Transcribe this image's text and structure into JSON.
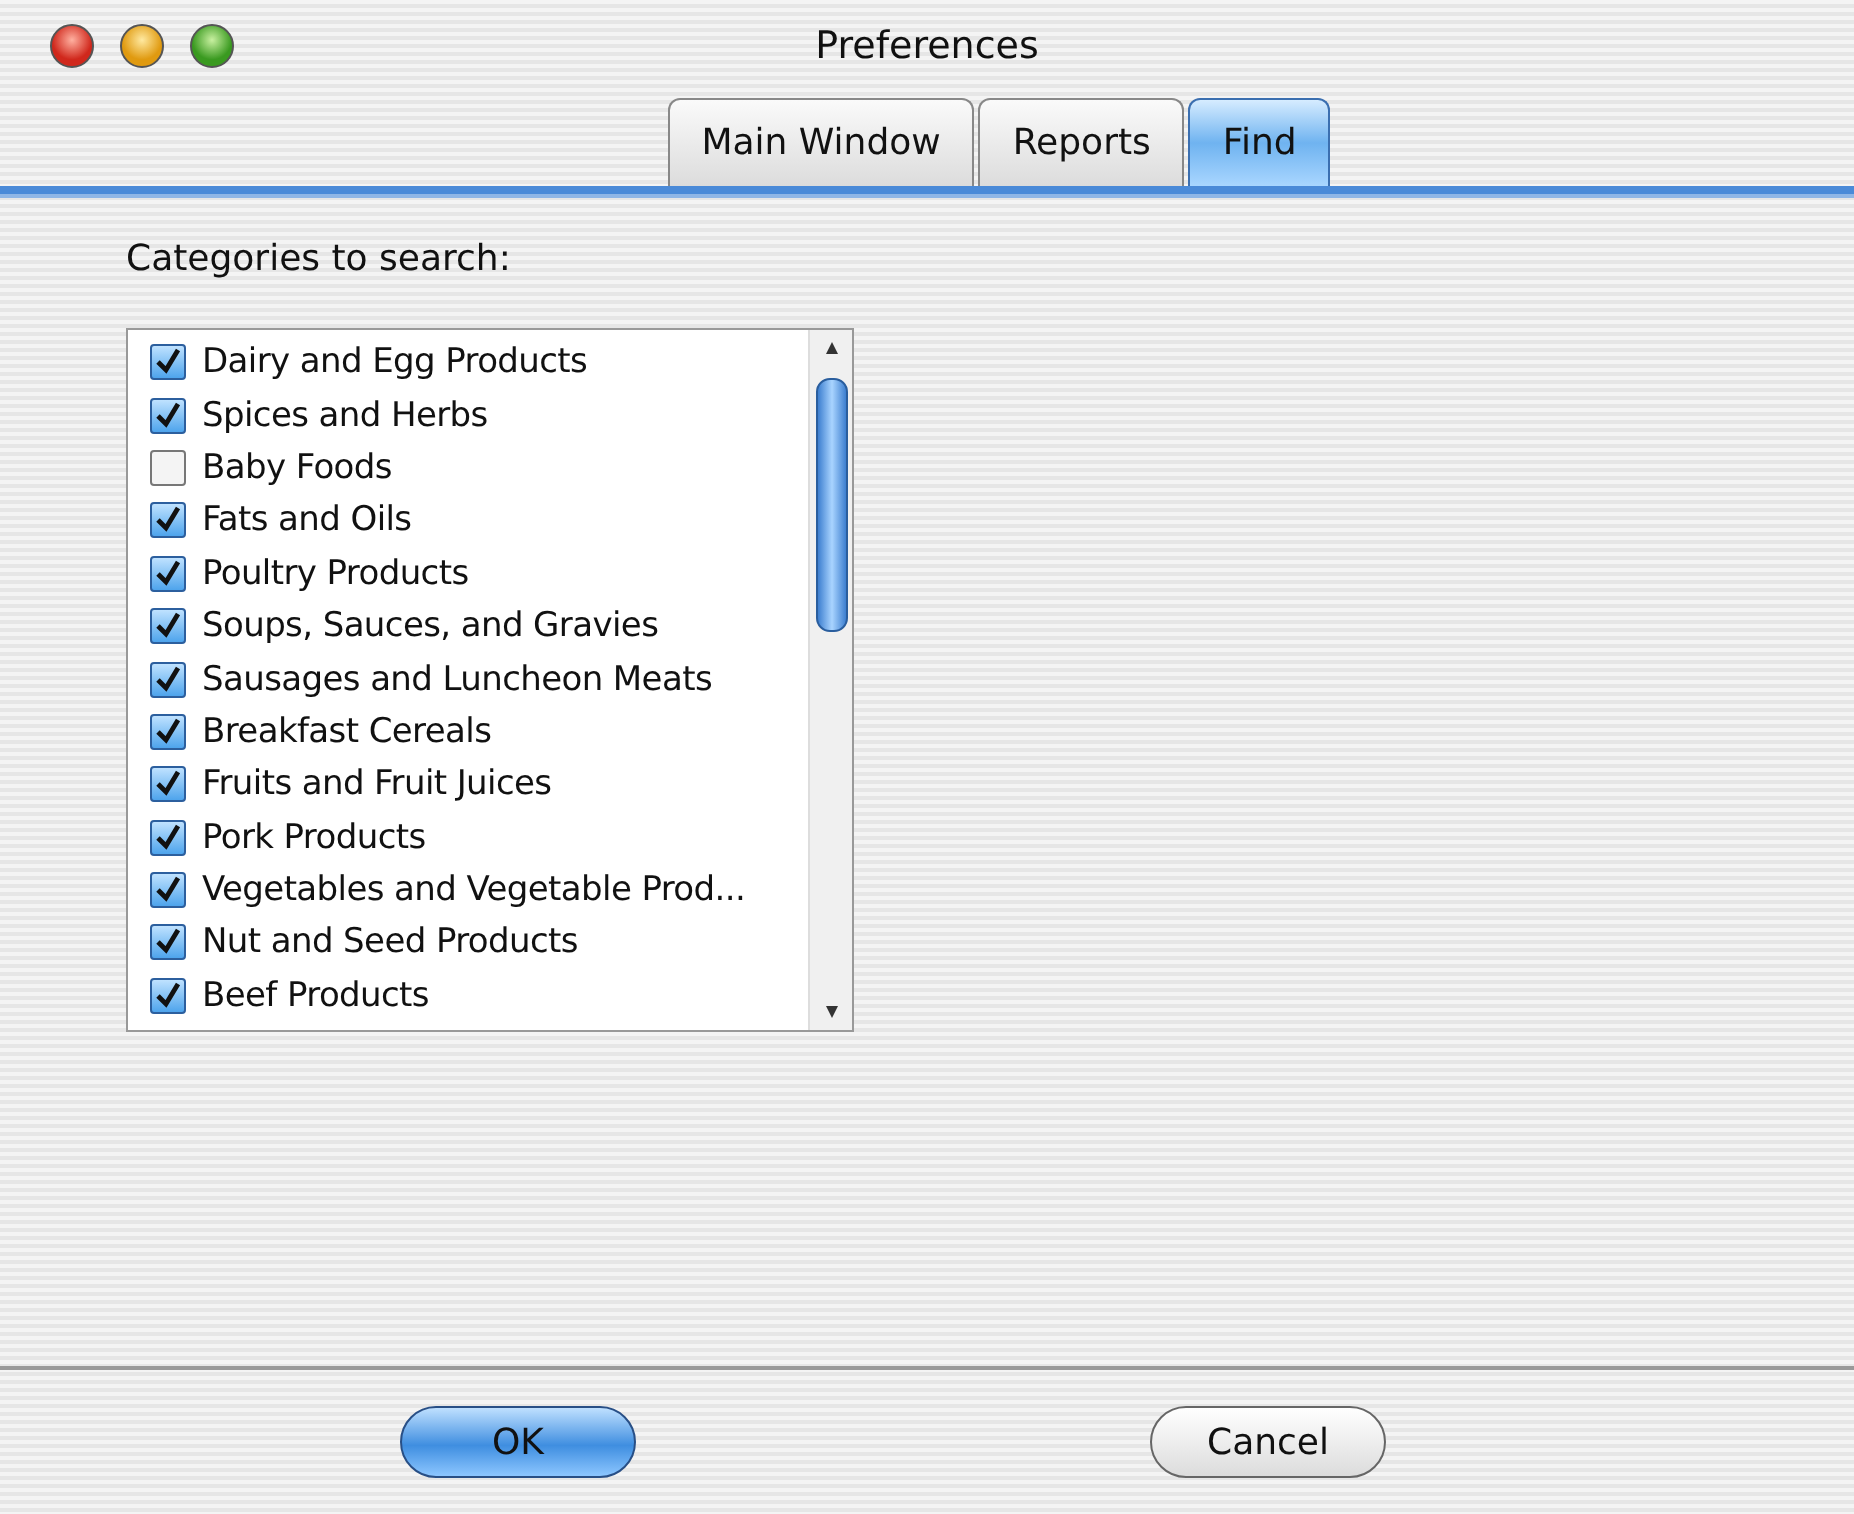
{
  "window": {
    "title": "Preferences"
  },
  "tabs": [
    {
      "label": "Main Window",
      "selected": false
    },
    {
      "label": "Reports",
      "selected": false
    },
    {
      "label": "Find",
      "selected": true
    }
  ],
  "categories_label": "Categories to search:",
  "categories": [
    {
      "label": "Dairy and Egg Products",
      "checked": true
    },
    {
      "label": "Spices and Herbs",
      "checked": true
    },
    {
      "label": "Baby Foods",
      "checked": false
    },
    {
      "label": "Fats and Oils",
      "checked": true
    },
    {
      "label": "Poultry Products",
      "checked": true
    },
    {
      "label": "Soups, Sauces, and Gravies",
      "checked": true
    },
    {
      "label": "Sausages and Luncheon Meats",
      "checked": true
    },
    {
      "label": "Breakfast Cereals",
      "checked": true
    },
    {
      "label": "Fruits and Fruit Juices",
      "checked": true
    },
    {
      "label": "Pork Products",
      "checked": true
    },
    {
      "label": "Vegetables and Vegetable Prod...",
      "checked": true
    },
    {
      "label": "Nut and Seed Products",
      "checked": true
    },
    {
      "label": "Beef Products",
      "checked": true
    }
  ],
  "buttons": [
    {
      "label": "OK",
      "default": true
    },
    {
      "label": "Cancel",
      "default": false
    }
  ]
}
